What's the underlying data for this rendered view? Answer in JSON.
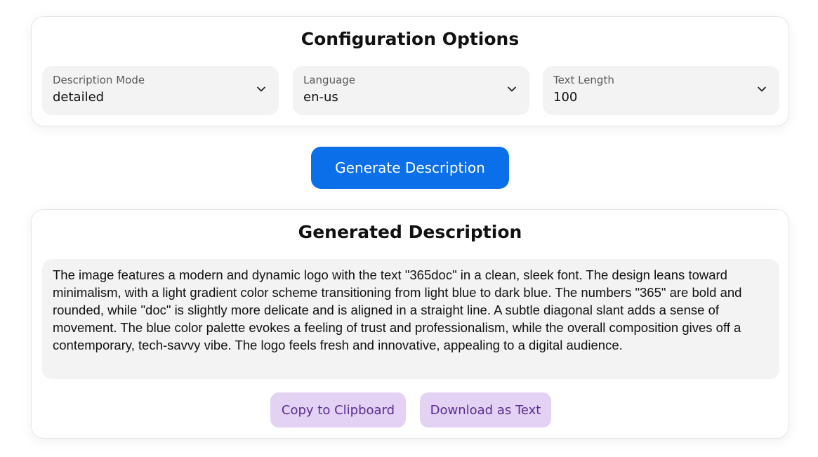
{
  "config": {
    "title": "Configuration Options",
    "selects": [
      {
        "label": "Description Mode",
        "value": "detailed"
      },
      {
        "label": "Language",
        "value": "en-us"
      },
      {
        "label": "Text Length",
        "value": "100"
      }
    ]
  },
  "actions": {
    "generate_label": "Generate Description"
  },
  "output": {
    "title": "Generated Description",
    "text": "The image features a modern and dynamic logo with the text \"365doc\" in a clean, sleek font. The design leans toward minimalism, with a light gradient color scheme transitioning from light blue to dark blue. The numbers \"365\" are bold and rounded, while \"doc\" is slightly more delicate and is aligned in a straight line. A subtle diagonal slant adds a sense of movement. The blue color palette evokes a feeling of trust and professionalism, while the overall composition gives off a contemporary, tech-savvy vibe. The logo feels fresh and innovative, appealing to a digital audience.",
    "copy_label": "Copy to Clipboard",
    "download_label": "Download as Text"
  },
  "colors": {
    "primary": "#0a6fe8",
    "secondary_bg": "#e3d2f3",
    "secondary_text": "#5b2d91",
    "field_bg": "#f3f3f3"
  },
  "icons": {
    "select_chevron": "chevron-down-icon"
  }
}
